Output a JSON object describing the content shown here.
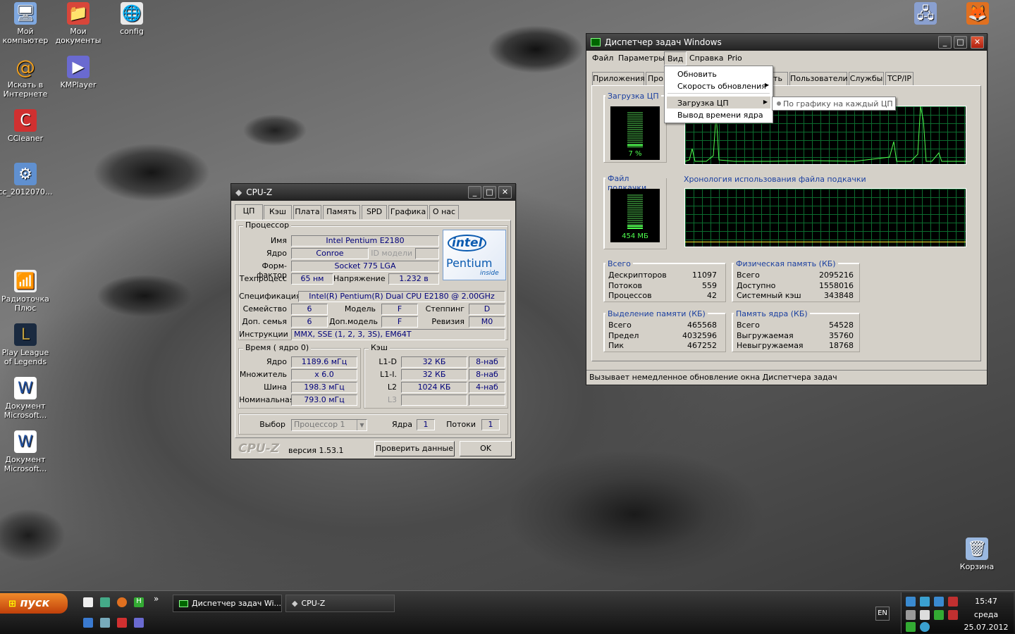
{
  "desktop": {
    "icons": [
      {
        "label": "Мой компьютер",
        "icon": "my-computer-icon",
        "color": "#7fa8e0"
      },
      {
        "label": "Мои документы",
        "icon": "my-documents-icon",
        "color": "#d8463a"
      },
      {
        "label": "config",
        "icon": "config-icon",
        "color": "#e8e8e8"
      },
      {
        "label": "Искать в Интернете",
        "icon": "search-internet-icon",
        "color": "#f0a020"
      },
      {
        "label": "KMPlayer",
        "icon": "kmplayer-icon",
        "color": "#6a6ad0"
      },
      {
        "label": "CCleaner",
        "icon": "ccleaner-icon",
        "color": "#d03030"
      },
      {
        "label": "cc_2012070...",
        "icon": "installer-icon",
        "color": "#6090d0"
      },
      {
        "label": "Радиоточка Плюс",
        "icon": "radio-icon",
        "color": "#40a040"
      },
      {
        "label": "Play League of Legends",
        "icon": "league-icon",
        "color": "#c0a040"
      },
      {
        "label": "Документ Microsoft...",
        "icon": "word-doc-icon",
        "color": "#ffffff"
      },
      {
        "label": "Документ Microsoft...",
        "icon": "word-doc-icon",
        "color": "#ffffff"
      },
      {
        "label": "Корзина",
        "icon": "recycle-bin-icon",
        "color": "#9ab8e0"
      }
    ]
  },
  "cpuz": {
    "title": "CPU-Z",
    "tabs": [
      "ЦП",
      "Кэш",
      "Плата",
      "Память",
      "SPD",
      "Графика",
      "О нас"
    ],
    "processor": {
      "group": "Процессор",
      "name_label": "Имя",
      "name": "Intel Pentium E2180",
      "core_label": "Ядро",
      "core": "Conroe",
      "id_label": "ID модели",
      "package_label": "Форм-фактор",
      "package": "Socket 775 LGA",
      "tech_label": "Техпроцесс",
      "tech": "65 нм",
      "voltage_label": "Напряжение",
      "voltage": "1.232 в",
      "spec_label": "Спецификация",
      "spec": "Intel(R) Pentium(R) Dual  CPU  E2180  @ 2.00GHz",
      "family_label": "Семейство",
      "family": "6",
      "model_label": "Модель",
      "model": "F",
      "stepping_label": "Степпинг",
      "stepping": "D",
      "extfamily_label": "Доп. семья",
      "extfamily": "6",
      "extmodel_label": "Доп.модель",
      "extmodel": "F",
      "revision_label": "Ревизия",
      "revision": "M0",
      "instr_label": "Инструкции",
      "instr": "MMX, SSE (1, 2, 3, 3S), EM64T"
    },
    "logo": {
      "brand": "intel",
      "product": "Pentium",
      "inside": "inside"
    },
    "clocks": {
      "group": "Время ( ядро 0)",
      "core_label": "Ядро",
      "core": "1189.6 мГц",
      "mult_label": "Множитель",
      "mult": "x 6.0",
      "bus_label": "Шина",
      "bus": "198.3 мГц",
      "rated_label": "Номинальная",
      "rated": "793.0 мГц"
    },
    "cache": {
      "group": "Кэш",
      "rows": [
        {
          "l": "L1-D",
          "s": "32 КБ",
          "w": "8-наб"
        },
        {
          "l": "L1-I.",
          "s": "32 КБ",
          "w": "8-наб"
        },
        {
          "l": "L2",
          "s": "1024 КБ",
          "w": "4-наб"
        },
        {
          "l": "L3",
          "s": "",
          "w": ""
        }
      ]
    },
    "selection": {
      "label": "Выбор",
      "value": "Процессор 1",
      "cores_label": "Ядра",
      "cores": "1",
      "threads_label": "Потоки",
      "threads": "1"
    },
    "footer": {
      "brand": "CPU-Z",
      "version": "версия 1.53.1",
      "validate": "Проверить данные",
      "ok": "OK"
    }
  },
  "taskmgr": {
    "title": "Диспетчер задач Windows",
    "menu": [
      "Файл",
      "Параметры",
      "Вид",
      "Справка",
      "Prio"
    ],
    "tabs": [
      "Приложения",
      "Про",
      "ть",
      "Пользователи",
      "Службы",
      "TCP/IP"
    ],
    "dropdown": [
      "Обновить",
      "Скорость обновления",
      "Загрузка ЦП",
      "Вывод времени ядра"
    ],
    "submenu": "По графику на каждый ЦП",
    "cpu_usage_label": "Загрузка ЦП",
    "cpu_usage": "7 %",
    "pagefile_label": "Файл подкачки",
    "pagefile": "454 МБ",
    "pagefile_history_label": "Хронология использования файла подкачки",
    "cpu_usage_level": 0.07,
    "totals": {
      "title": "Всего",
      "rows": [
        {
          "k": "Дескрипторов",
          "v": "11097"
        },
        {
          "k": "Потоков",
          "v": "559"
        },
        {
          "k": "Процессов",
          "v": "42"
        }
      ]
    },
    "physical": {
      "title": "Физическая память (КБ)",
      "rows": [
        {
          "k": "Всего",
          "v": "2095216"
        },
        {
          "k": "Доступно",
          "v": "1558016"
        },
        {
          "k": "Системный кэш",
          "v": "343848"
        }
      ]
    },
    "commit": {
      "title": "Выделение памяти (КБ)",
      "rows": [
        {
          "k": "Всего",
          "v": "465568"
        },
        {
          "k": "Предел",
          "v": "4032596"
        },
        {
          "k": "Пик",
          "v": "467252"
        }
      ]
    },
    "kernel": {
      "title": "Память ядра (КБ)",
      "rows": [
        {
          "k": "Всего",
          "v": "54528"
        },
        {
          "k": "Выгружаемая",
          "v": "35760"
        },
        {
          "k": "Невыгружаемая",
          "v": "18768"
        }
      ]
    },
    "status": "Вызывает немедленное обновление окна Диспетчера задач"
  },
  "taskbar": {
    "start": "пуск",
    "tasks": [
      "Диспетчер задач Wi...",
      "CPU-Z"
    ],
    "lang": "EN",
    "time": "15:47",
    "day": "среда",
    "date": "25.07.2012",
    "more": "»"
  }
}
